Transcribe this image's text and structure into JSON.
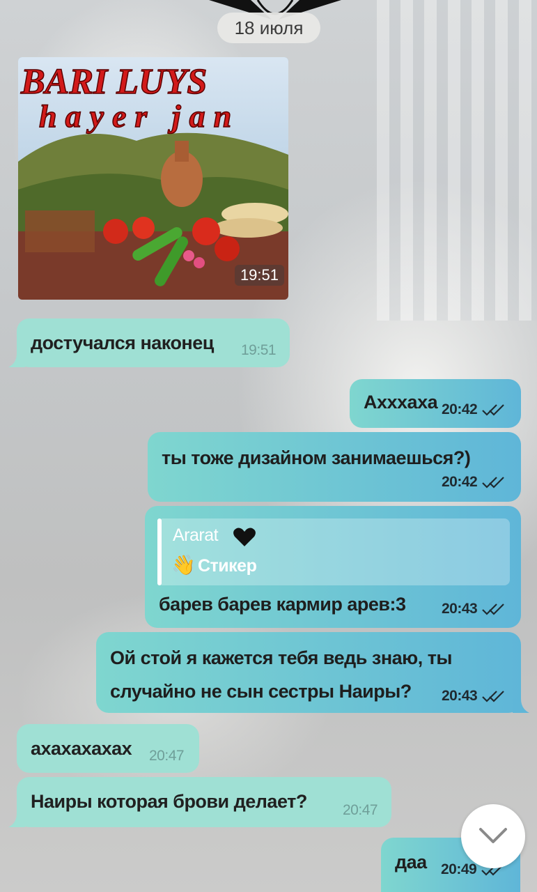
{
  "date_separator": "18 июля",
  "photo_message": {
    "time": "19:51"
  },
  "messages": [
    {
      "direction": "in",
      "text": "достучался наконец",
      "time": "19:51"
    },
    {
      "direction": "out",
      "text": "Ахххаха",
      "time": "20:42",
      "status": "read"
    },
    {
      "direction": "out",
      "text": "ты тоже дизайном занимаешься?)",
      "time": "20:42",
      "status": "read"
    },
    {
      "direction": "out",
      "reply_to": {
        "author": "Ararat",
        "emoji": "👋",
        "preview": "Стикер"
      },
      "text": "барев барев кармир арев:3",
      "time": "20:43",
      "status": "read"
    },
    {
      "direction": "out",
      "lines": [
        "Ой стой я кажется тебя ведь знаю, ты",
        "случайно не сын сестры Наиры?"
      ],
      "time": "20:43",
      "status": "read"
    },
    {
      "direction": "in",
      "text": "ахахахахах",
      "time": "20:47"
    },
    {
      "direction": "in",
      "text": "Наиры которая брови делает?",
      "time": "20:47"
    },
    {
      "direction": "out",
      "text": "даа",
      "time": "20:49",
      "status": "read"
    }
  ],
  "colors": {
    "incoming_bubble": "#9fe0d4",
    "outgoing_gradient_start": "#7fd6cf",
    "outgoing_gradient_end": "#5fb6d8"
  },
  "icons": {
    "read_status": "double-check-icon",
    "scroll_down": "chevron-down-icon",
    "reply_heart": "black-heart-icon"
  }
}
